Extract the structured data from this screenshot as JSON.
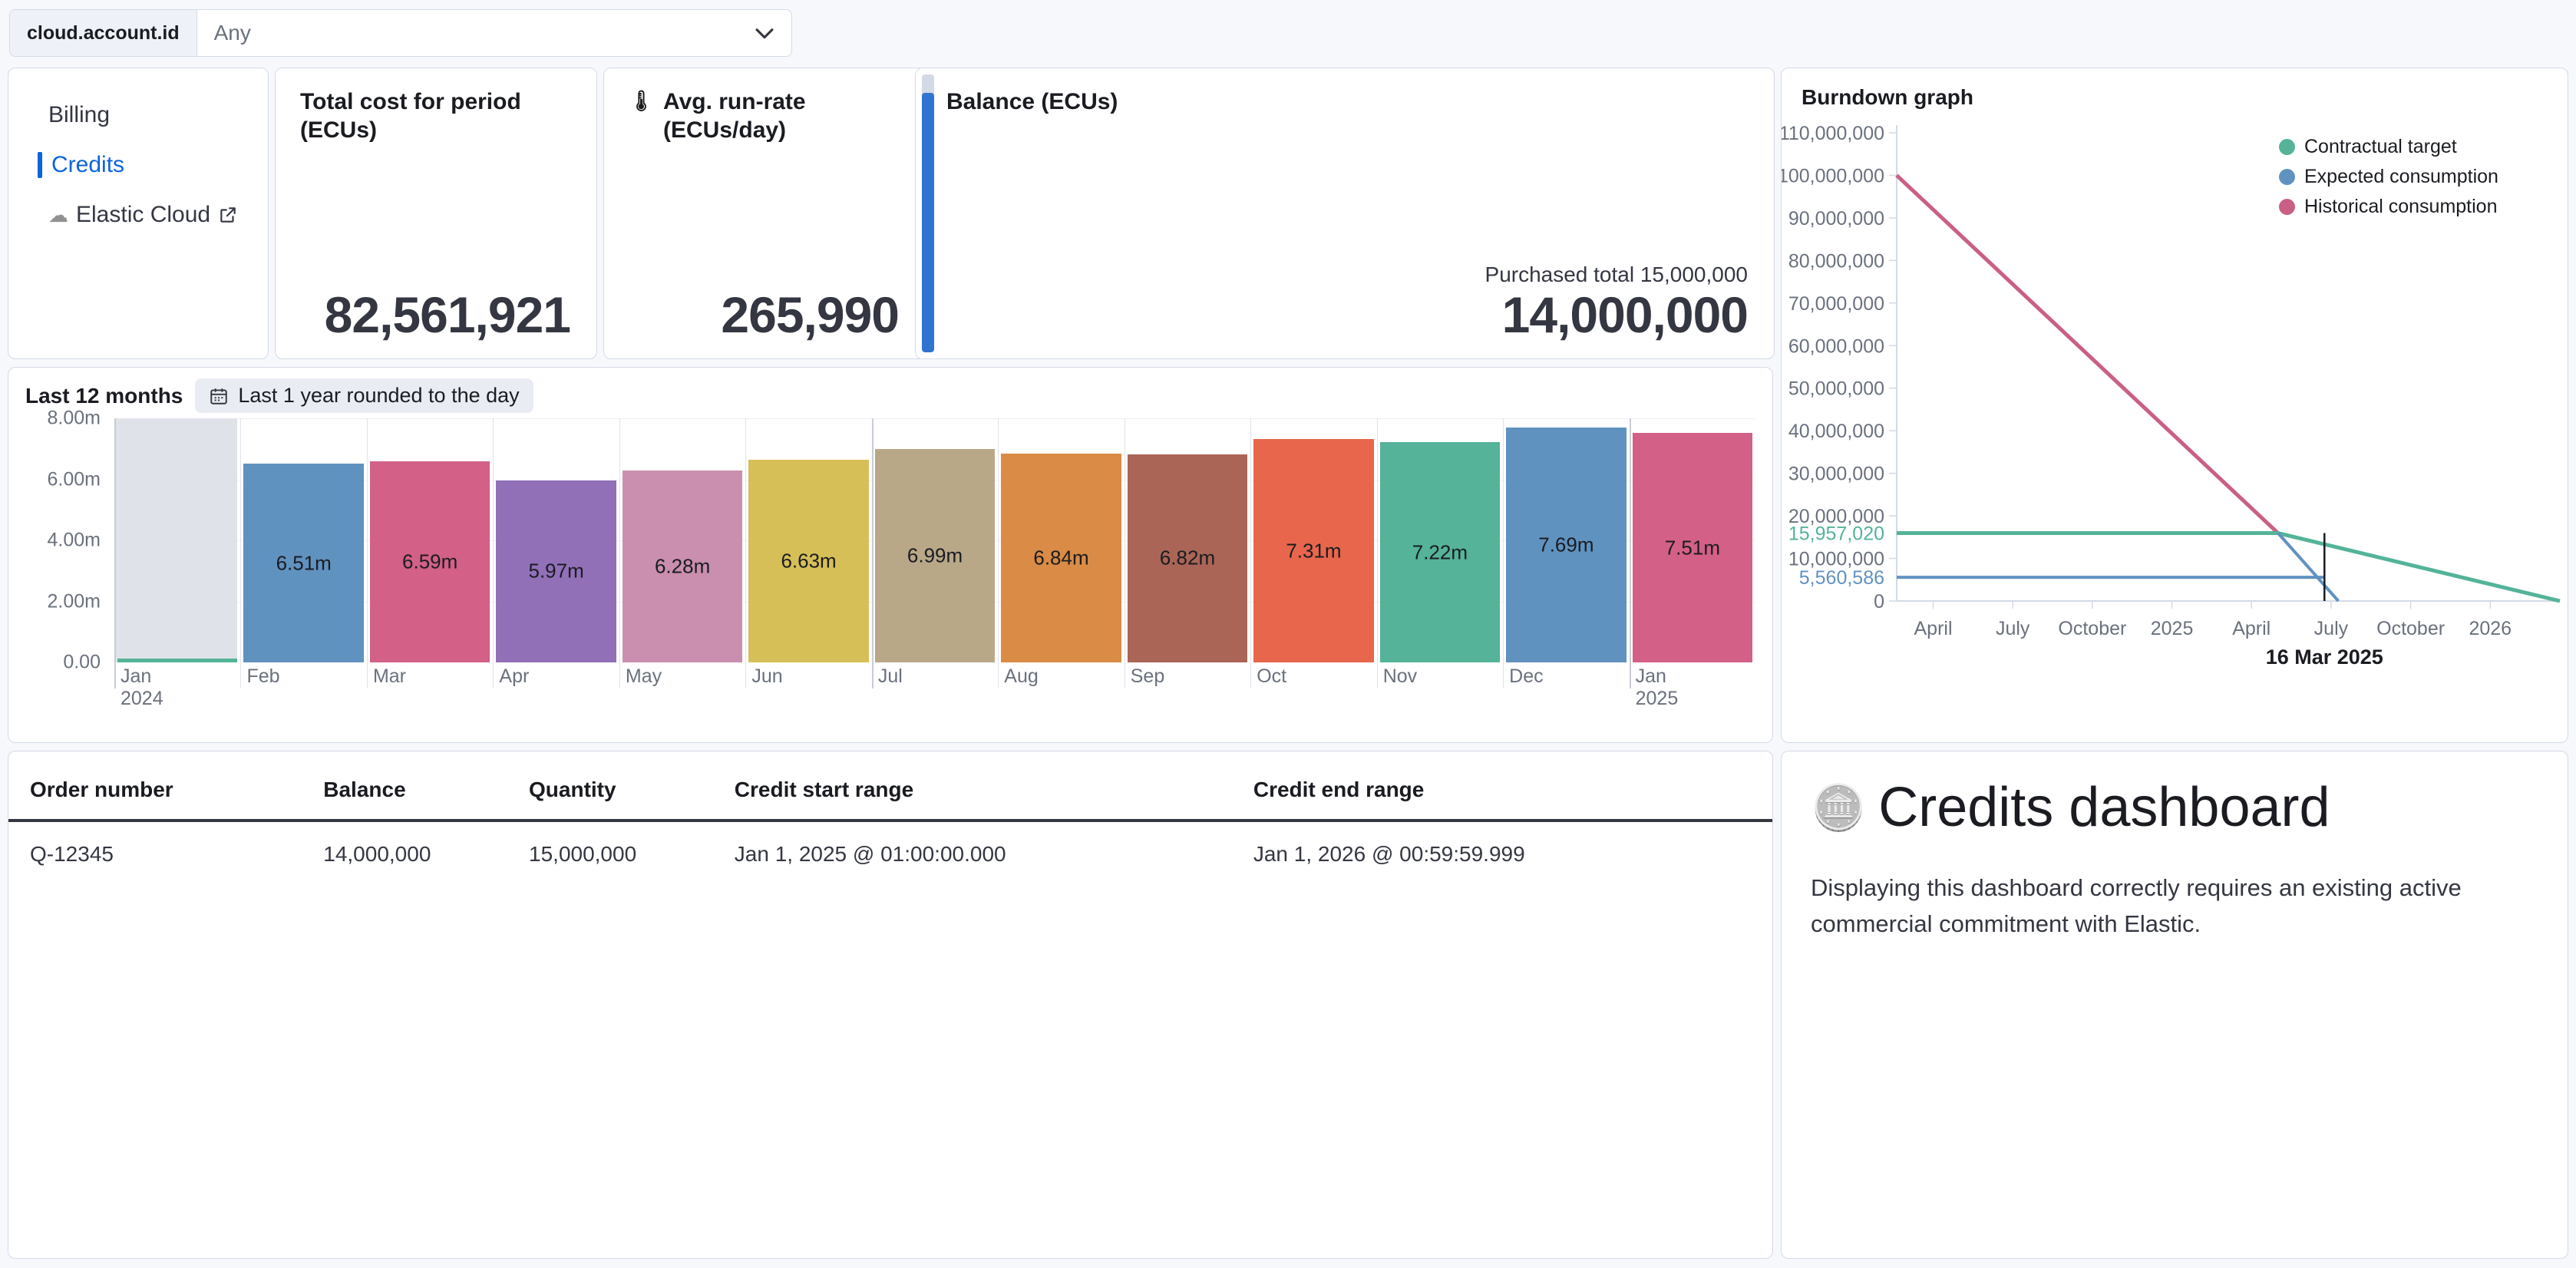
{
  "filter": {
    "key": "cloud.account.id",
    "value": "Any",
    "caret_icon": "chevron-down-icon"
  },
  "nav": {
    "items": [
      {
        "label": "Billing",
        "active": false,
        "external": false
      },
      {
        "label": "Credits",
        "active": true,
        "external": false
      },
      {
        "label": "Elastic Cloud",
        "active": false,
        "external": true,
        "icon": "cloud-icon",
        "external_icon": "external-link-icon"
      }
    ]
  },
  "metrics": {
    "total_cost": {
      "title": "Total cost for period (ECUs)",
      "value": "82,561,921"
    },
    "run_rate": {
      "icon": "thermometer-icon",
      "title": "Avg. run-rate (ECUs/day)",
      "value": "265,990"
    },
    "balance": {
      "title": "Balance (ECUs)",
      "subtitle": "Purchased total 15,000,000",
      "value": "14,000,000",
      "gauge_percent": 93.3,
      "gauge_color": "#2f74d0"
    }
  },
  "bars_panel": {
    "label": "Last 12 months",
    "range_icon": "calendar-icon",
    "range_label": "Last 1 year rounded to the day"
  },
  "table": {
    "columns": [
      "Order number",
      "Balance",
      "Quantity",
      "Credit start range",
      "Credit end range"
    ],
    "rows": [
      [
        "Q-12345",
        "14,000,000",
        "15,000,000",
        "Jan 1, 2025 @ 01:00:00.000",
        "Jan 1, 2026 @ 00:59:59.999"
      ]
    ]
  },
  "markdown": {
    "icon": "coin-icon",
    "title": "Credits dashboard",
    "body": "Displaying this dashboard correctly requires an existing active commercial commitment with Elastic."
  },
  "burndown": {
    "title": "Burndown graph",
    "legend": [
      {
        "label": "Contractual target",
        "color": "#54b399"
      },
      {
        "label": "Expected consumption",
        "color": "#6092c0"
      },
      {
        "label": "Historical consumption",
        "color": "#ca5f86"
      }
    ],
    "marker_label": "16 Mar 2025"
  },
  "chart_data": [
    {
      "type": "bar",
      "title": "Last 12 months",
      "xlabel": "",
      "ylabel": "",
      "ylim": [
        0,
        8000000
      ],
      "yticks": [
        "0.00",
        "2.00m",
        "4.00m",
        "6.00m",
        "8.00m"
      ],
      "grid": true,
      "categories": [
        "Jan 2024",
        "Feb",
        "Mar",
        "Apr",
        "May",
        "Jun",
        "Jul",
        "Aug",
        "Sep",
        "Oct",
        "Nov",
        "Dec",
        "Jan 2025"
      ],
      "value_labels": [
        "",
        "6.51m",
        "6.59m",
        "5.97m",
        "6.28m",
        "6.63m",
        "6.99m",
        "6.84m",
        "6.82m",
        "7.31m",
        "7.22m",
        "7.69m",
        "7.51m"
      ],
      "values": [
        0.12,
        6.51,
        6.59,
        5.97,
        6.28,
        6.63,
        6.99,
        6.84,
        6.82,
        7.31,
        7.22,
        7.69,
        7.51
      ],
      "unit": "millions of ECUs",
      "colors": [
        "#54b399",
        "#6092c0",
        "#d36086",
        "#9170b8",
        "#ca8eae",
        "#d6bf57",
        "#b9a888",
        "#da8b45",
        "#aa6556",
        "#e7664c",
        "#54b399",
        "#6092c0",
        "#d36086"
      ],
      "hover_highlight_index": 0
    },
    {
      "type": "line",
      "title": "Burndown graph",
      "xlabel": "",
      "ylabel": "",
      "ylim": [
        0,
        110000000
      ],
      "yticks": [
        "0",
        "10,000,000",
        "20,000,000",
        "30,000,000",
        "40,000,000",
        "50,000,000",
        "60,000,000",
        "70,000,000",
        "80,000,000",
        "90,000,000",
        "100,000,000",
        "110,000,000"
      ],
      "highlight_yticks": [
        {
          "label": "15,957,020",
          "value": 15957020,
          "color": "#54b399"
        },
        {
          "label": "5,560,586",
          "value": 5560586,
          "color": "#6092c0"
        }
      ],
      "xticks": [
        "April",
        "July",
        "October",
        "2025",
        "April",
        "July",
        "October",
        "2026"
      ],
      "grid": false,
      "legend_position": "top-right",
      "annotation": {
        "label": "16 Mar 2025",
        "x_value": "2025-03-16"
      },
      "series": [
        {
          "name": "Historical consumption",
          "color": "#ca5f86",
          "points": [
            [
              0.0,
              100000000
            ],
            [
              0.575,
              15957020
            ]
          ]
        },
        {
          "name": "Contractual target",
          "color": "#54b399",
          "points": [
            [
              0.0,
              15957020
            ],
            [
              0.575,
              15957020
            ],
            [
              1.0,
              0
            ]
          ]
        },
        {
          "name": "Expected consumption",
          "color": "#6092c0",
          "points": [
            [
              0.0,
              5560586
            ],
            [
              0.645,
              5560586
            ],
            [
              0.575,
              15957020
            ],
            [
              0.665,
              0
            ]
          ]
        }
      ]
    }
  ]
}
